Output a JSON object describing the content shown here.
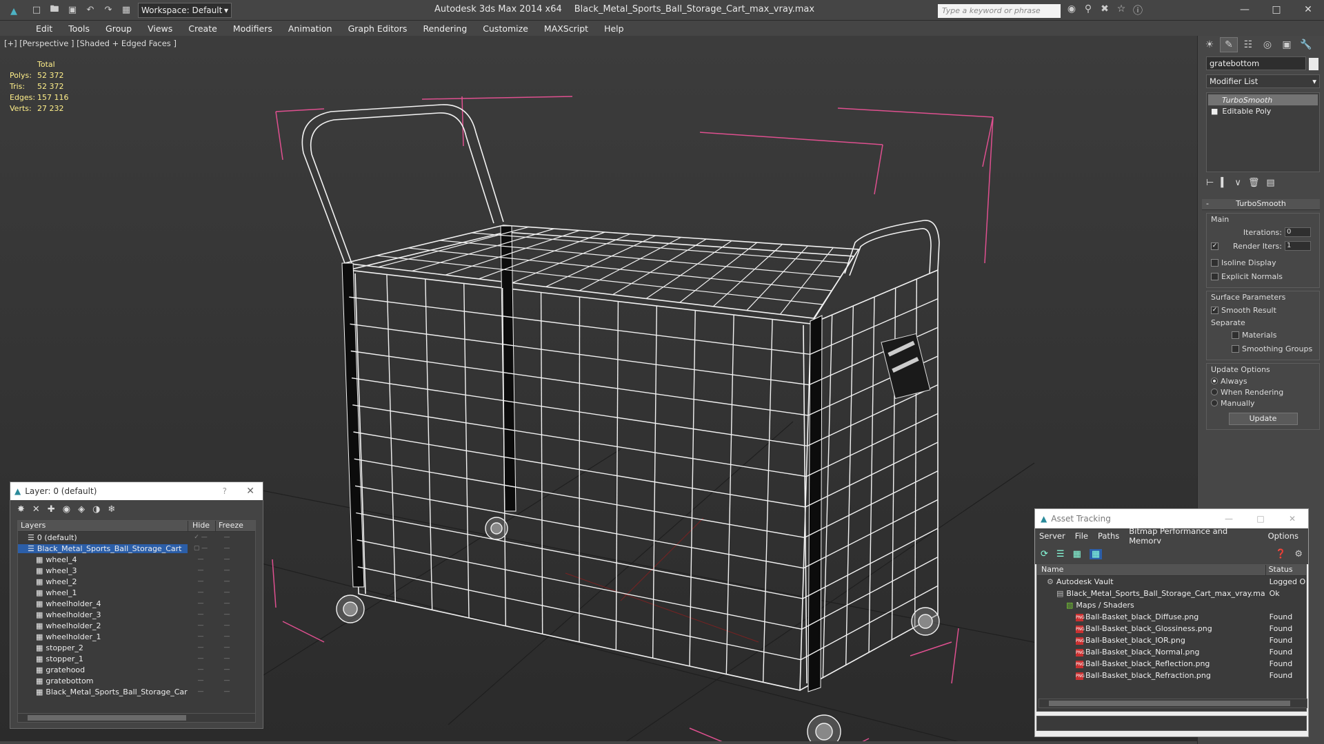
{
  "titlebar": {
    "workspace": "Workspace: Default",
    "app_name": "Autodesk 3ds Max  2014 x64",
    "file_name": "Black_Metal_Sports_Ball_Storage_Cart_max_vray.max",
    "search_placeholder": "Type a keyword or phrase"
  },
  "menu": [
    "Edit",
    "Tools",
    "Group",
    "Views",
    "Create",
    "Modifiers",
    "Animation",
    "Graph Editors",
    "Rendering",
    "Customize",
    "MAXScript",
    "Help"
  ],
  "viewport": {
    "label": "[+] [Perspective ] [Shaded + Edged Faces ]",
    "stats": {
      "header": "Total",
      "rows": [
        {
          "k": "Polys:",
          "v": "52 372"
        },
        {
          "k": "Tris:",
          "v": "52 372"
        },
        {
          "k": "Edges:",
          "v": "157 116"
        },
        {
          "k": "Verts:",
          "v": "27 232"
        }
      ]
    }
  },
  "command_panel": {
    "object_name": "gratebottom",
    "modifier_list": "Modifier List",
    "stack": [
      "TurboSmooth",
      "Editable Poly"
    ],
    "rollout_title": "TurboSmooth",
    "main_group": "Main",
    "iterations_label": "Iterations:",
    "iterations_value": "0",
    "render_iters_label": "Render Iters:",
    "render_iters_value": "1",
    "isoline_label": "Isoline Display",
    "explicit_normals_label": "Explicit Normals",
    "surface_group": "Surface Parameters",
    "smooth_result_label": "Smooth Result",
    "separate_label": "Separate",
    "materials_label": "Materials",
    "smoothing_groups_label": "Smoothing Groups",
    "update_group": "Update Options",
    "always_label": "Always",
    "when_rendering_label": "When Rendering",
    "manually_label": "Manually",
    "update_button": "Update"
  },
  "layer_window": {
    "title": "Layer: 0 (default)",
    "help": "?",
    "col_layers": "Layers",
    "col_hide": "Hide",
    "col_freeze": "Freeze",
    "rows": [
      {
        "name": "0 (default)",
        "indent": 1
      },
      {
        "name": "Black_Metal_Sports_Ball_Storage_Cart",
        "indent": 1
      },
      {
        "name": "wheel_4",
        "indent": 2
      },
      {
        "name": "wheel_3",
        "indent": 2
      },
      {
        "name": "wheel_2",
        "indent": 2
      },
      {
        "name": "wheel_1",
        "indent": 2
      },
      {
        "name": "wheelholder_4",
        "indent": 2
      },
      {
        "name": "wheelholder_3",
        "indent": 2
      },
      {
        "name": "wheelholder_2",
        "indent": 2
      },
      {
        "name": "wheelholder_1",
        "indent": 2
      },
      {
        "name": "stopper_2",
        "indent": 2
      },
      {
        "name": "stopper_1",
        "indent": 2
      },
      {
        "name": "gratehood",
        "indent": 2
      },
      {
        "name": "gratebottom",
        "indent": 2
      },
      {
        "name": "Black_Metal_Sports_Ball_Storage_Cart",
        "indent": 2
      }
    ]
  },
  "asset_window": {
    "title": "Asset Tracking",
    "menu": [
      "Server",
      "File",
      "Paths",
      "Bitmap Performance and Memory",
      "Options"
    ],
    "col_name": "Name",
    "col_status": "Status",
    "rows": [
      {
        "name": "Autodesk Vault",
        "status": "Logged O",
        "indent": 1
      },
      {
        "name": "Black_Metal_Sports_Ball_Storage_Cart_max_vray.max",
        "status": "Ok",
        "indent": 2
      },
      {
        "name": "Maps / Shaders",
        "status": "",
        "indent": 3
      },
      {
        "name": "Ball-Basket_black_Diffuse.png",
        "status": "Found",
        "indent": 4
      },
      {
        "name": "Ball-Basket_black_Glossiness.png",
        "status": "Found",
        "indent": 4
      },
      {
        "name": "Ball-Basket_black_IOR.png",
        "status": "Found",
        "indent": 4
      },
      {
        "name": "Ball-Basket_black_Normal.png",
        "status": "Found",
        "indent": 4
      },
      {
        "name": "Ball-Basket_black_Reflection.png",
        "status": "Found",
        "indent": 4
      },
      {
        "name": "Ball-Basket_black_Refraction.png",
        "status": "Found",
        "indent": 4
      }
    ]
  },
  "colors": {
    "accent": "#2a8a9a",
    "selection": "#2b5ea8",
    "stats_text": "#ffef8a",
    "bbox": "#e05090",
    "wire": "#f2f2f2"
  }
}
